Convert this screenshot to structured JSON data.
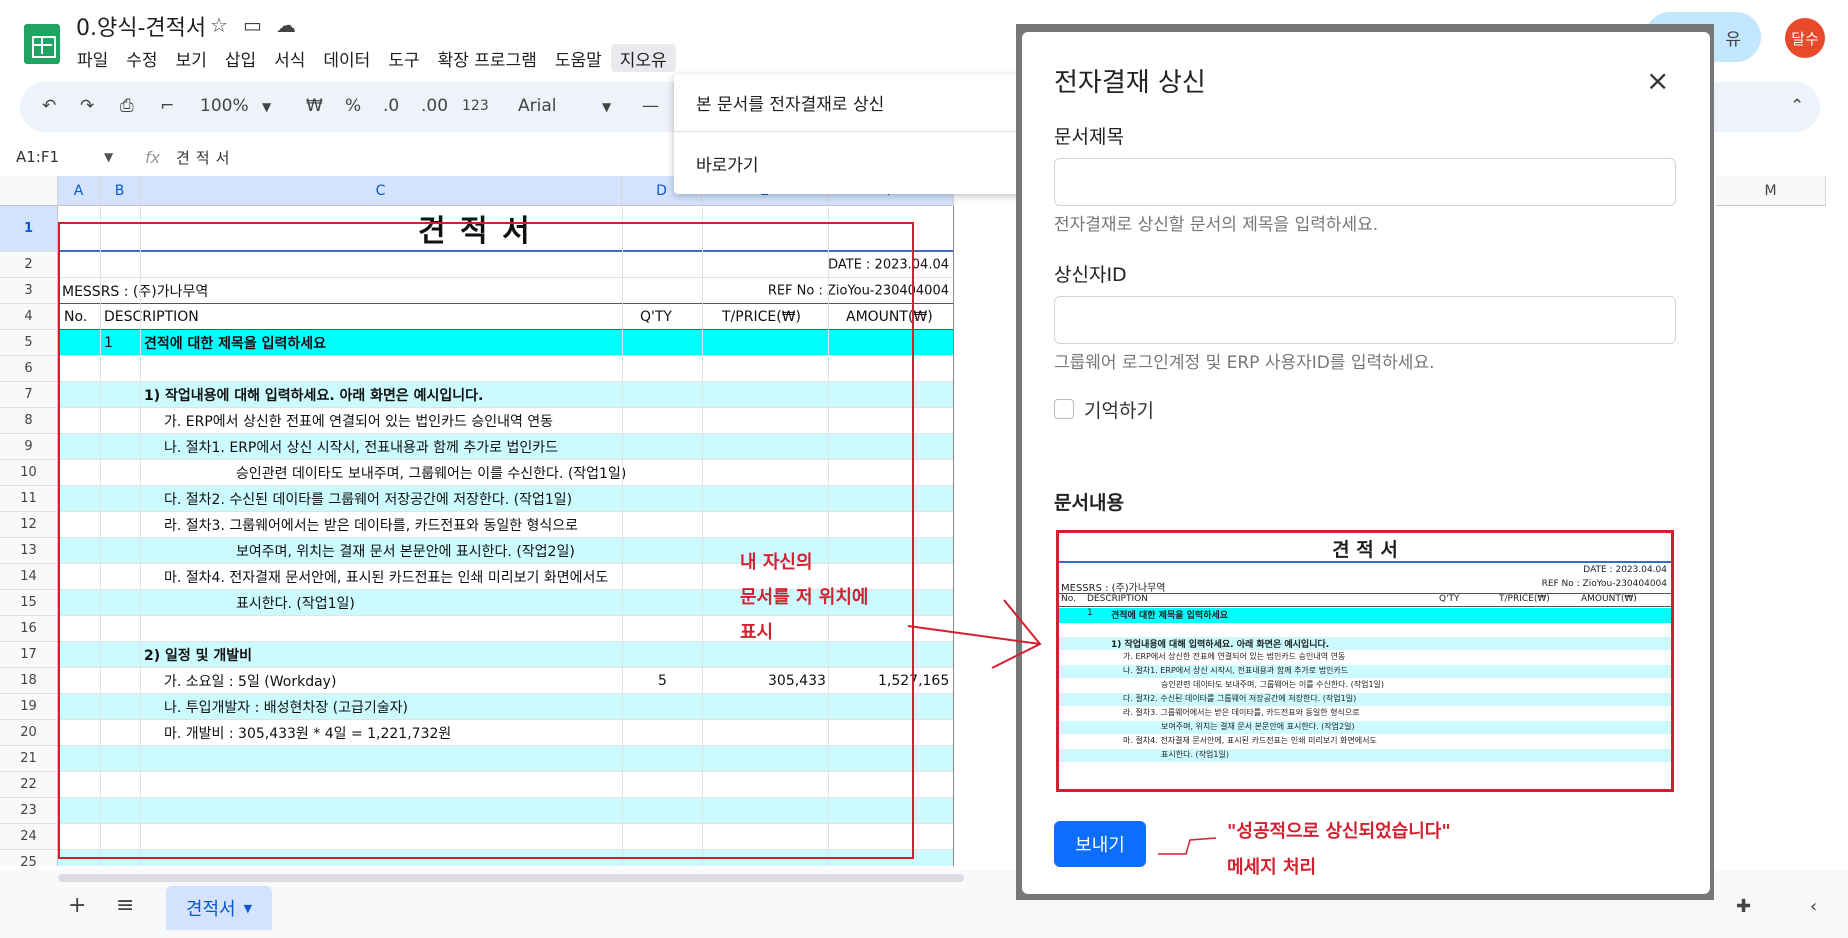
{
  "header": {
    "doc_title": "0.양식-견적서",
    "menus": [
      "파일",
      "수정",
      "보기",
      "삽입",
      "서식",
      "데이터",
      "도구",
      "확장 프로그램",
      "도움말",
      "지오유"
    ],
    "share_label": "유",
    "avatar_text": "달수"
  },
  "toolbar": {
    "zoom": "100%",
    "currency": "₩",
    "percent": "%",
    "dec_less": ".0",
    "dec_more": ".00",
    "format_123": "123",
    "font": "Arial",
    "minus": "—"
  },
  "formula_bar": {
    "namebox": "A1:F1",
    "fx": "fx",
    "content": "견적서"
  },
  "columns": [
    "A",
    "B",
    "C",
    "D",
    "E",
    "F",
    "M"
  ],
  "row_numbers": [
    "1",
    "2",
    "3",
    "4",
    "5",
    "6",
    "7",
    "8",
    "9",
    "10",
    "11",
    "12",
    "13",
    "14",
    "15",
    "16",
    "17",
    "18",
    "19",
    "20",
    "21",
    "22",
    "23",
    "24",
    "25"
  ],
  "sheet": {
    "title": "견  적  서",
    "date": "DATE : 2023.04.04",
    "messrs": "MESSRS : (주)가나무역",
    "ref": "REF No : ZioYou-230404004",
    "headers": {
      "no": "No.",
      "desc": "DESCRIPTION",
      "qty": "Q'TY",
      "tprice": "T/PRICE(₩)",
      "amount": "AMOUNT(₩)"
    },
    "row5_no": "1",
    "row5_desc": "견적에 대한 제목을 입력하세요",
    "r7": "1) 작업내용에 대해 입력하세요. 아래 화면은 예시입니다.",
    "r8": "가. ERP에서 상신한 전표에 연결되어 있는 법인카드 승인내역 연동",
    "r9": "나. 절차1. ERP에서 상신 시작시, 전표내용과 함께 추가로 법인카드",
    "r10": "승인관련 데이타도 보내주며, 그룹웨어는 이를 수신한다. (작업1일)",
    "r11": "다. 절차2. 수신된 데이타를 그룹웨어 저장공간에 저장한다. (작업1일)",
    "r12": "라. 절차3. 그룹웨어에서는 받은 데이타를, 카드전표와 동일한 형식으로",
    "r13": "보여주며, 위치는 결재 문서 본문안에 표시한다. (작업2일)",
    "r14": "마. 절차4. 전자결재 문서안에, 표시된 카드전표는 인쇄 미리보기 화면에서도",
    "r15": "표시한다. (작업1일)",
    "r17": "2) 일정 및 개발비",
    "r18": "가. 소요일 : 5일 (Workday)",
    "r18_qty": "5",
    "r18_price": "305,433",
    "r18_amount": "1,527,165",
    "r19": "나. 투입개발자 : 배성현차장 (고급기술자)",
    "r20": "마. 개발비 : 305,433원 * 4일 = 1,221,732원"
  },
  "annotations": {
    "left_1": "내 자신의",
    "left_2": "문서를 저 위치에",
    "left_3": "표시",
    "msg_1": "\"성공적으로 상신되었습니다\"",
    "msg_2": "메세지 처리"
  },
  "dropdown": {
    "item1": "본 문서를 전자결재로 상신",
    "item2": "바로가기"
  },
  "modal": {
    "title": "전자결재 상신",
    "doc_title_label": "문서제목",
    "doc_title_help": "전자결재로 상신할 문서의 제목을 입력하세요.",
    "submitter_label": "상신자ID",
    "submitter_help": "그룹웨어 로그인계정 및 ERP 사용자ID를 입력하세요.",
    "remember_label": "기억하기",
    "content_label": "문서내용",
    "send_label": "보내기"
  },
  "bottom": {
    "sheet_tab": "견적서",
    "add": "+",
    "menu": "≡"
  }
}
